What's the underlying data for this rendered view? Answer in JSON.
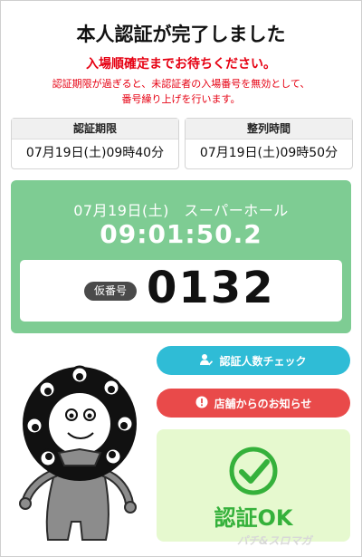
{
  "header": {
    "title": "本人認証が完了しました",
    "wait_message": "入場順確定までお待ちください。",
    "note_line1": "認証期限が過ぎると、未認証者の入場番号を無効として、",
    "note_line2": "番号繰り上げを行います。"
  },
  "auth_deadline": {
    "label": "認証期限",
    "value": "07月19日(土)09時40分"
  },
  "line_up_time": {
    "label": "整列時間",
    "value": "07月19日(土)09時50分"
  },
  "status_panel": {
    "date_venue": "07月19日(土)　スーパーホール",
    "clock": "09:01:50.2",
    "temp_number_label": "仮番号",
    "temp_number": "0132"
  },
  "buttons": {
    "check_count": "認証人数チェック",
    "store_notice": "店舗からのお知らせ"
  },
  "auth_result": {
    "label": "認証OK"
  },
  "watermark": "パチ&スロマガ",
  "colors": {
    "alert_red": "#e60012",
    "panel_green": "#7ecc93",
    "button_blue": "#2fbcd6",
    "button_red": "#e94a4a",
    "ok_green": "#35b13b",
    "ok_bg": "#e6f9cf"
  },
  "icons": {
    "check_count": "person-check-icon",
    "store_notice": "alert-circle-icon",
    "auth_result": "check-circle-icon",
    "mascot": "mascot-illustration"
  }
}
